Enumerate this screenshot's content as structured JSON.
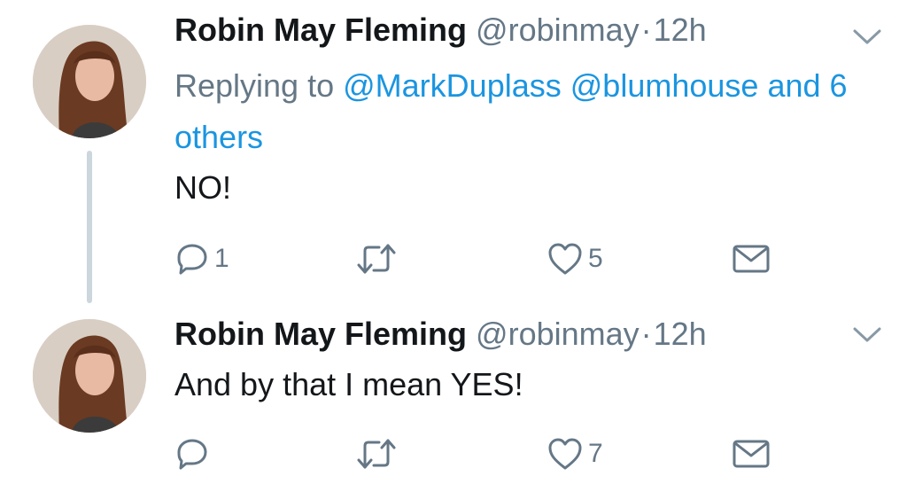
{
  "colors": {
    "text": "#14171a",
    "secondary": "#657786",
    "link": "#1b95e0",
    "thread_line": "#ccd6dd",
    "icon": "#657786"
  },
  "tweets": [
    {
      "display_name": "Robin May Fleming",
      "handle": "@robinmay",
      "separator": "·",
      "time": "12h",
      "replying_prefix": "Replying to",
      "mentions": [
        "@MarkDuplass",
        "@blumhouse"
      ],
      "others": "and 6 others",
      "text": "NO!",
      "reply_count": "1",
      "retweet_count": "",
      "like_count": "5",
      "icons": {
        "more": "chevron-down-icon",
        "reply": "reply-icon",
        "retweet": "retweet-icon",
        "like": "heart-icon",
        "dm": "envelope-icon"
      }
    },
    {
      "display_name": "Robin May Fleming",
      "handle": "@robinmay",
      "separator": "·",
      "time": "12h",
      "text": "And by that I mean YES!",
      "reply_count": "",
      "retweet_count": "",
      "like_count": "7",
      "icons": {
        "more": "chevron-down-icon",
        "reply": "reply-icon",
        "retweet": "retweet-icon",
        "like": "heart-icon",
        "dm": "envelope-icon"
      }
    }
  ]
}
